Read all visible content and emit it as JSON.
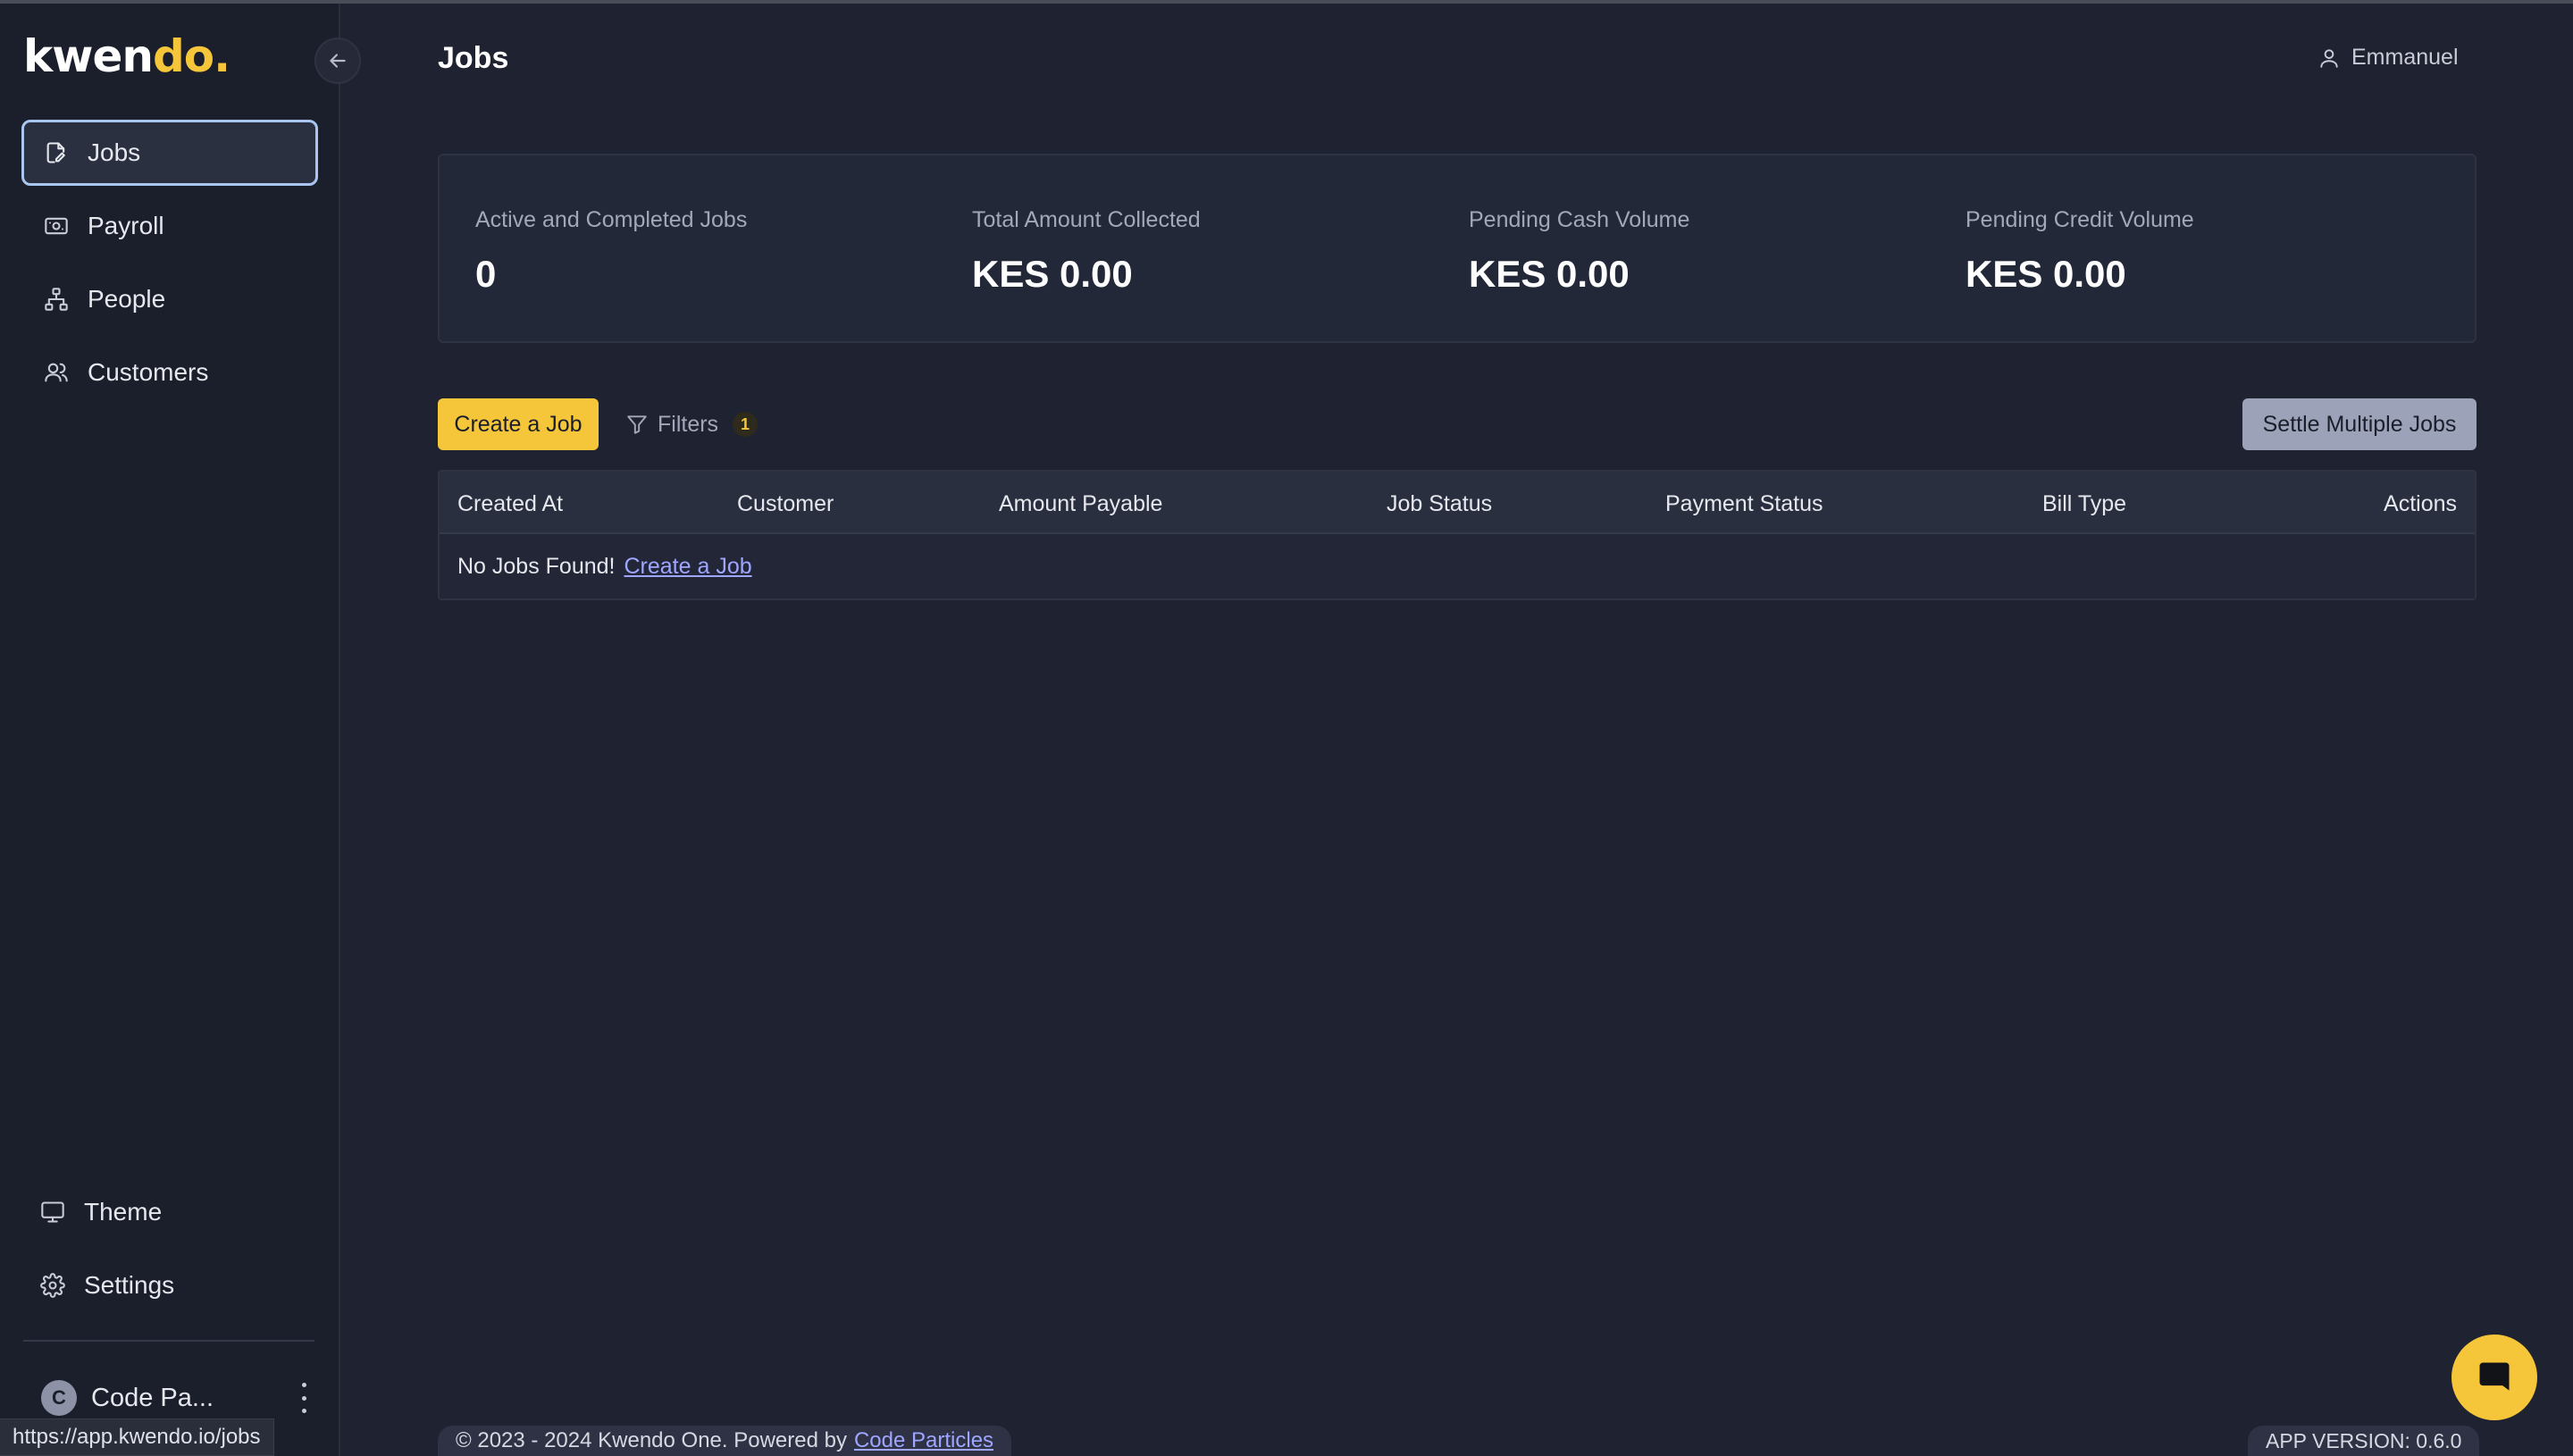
{
  "brand": {
    "logo_main": "kwen",
    "logo_accent": "do."
  },
  "sidebar": {
    "items": [
      {
        "label": "Jobs",
        "icon": "job-edit-icon",
        "active": true
      },
      {
        "label": "Payroll",
        "icon": "cash-icon"
      },
      {
        "label": "People",
        "icon": "org-chart-icon"
      },
      {
        "label": "Customers",
        "icon": "users-icon"
      }
    ],
    "bottom_items": [
      {
        "label": "Theme",
        "icon": "monitor-icon"
      },
      {
        "label": "Settings",
        "icon": "gear-icon"
      }
    ],
    "org": {
      "avatar_initial": "C",
      "name": "Code Pa..."
    },
    "status_url": "https://app.kwendo.io/jobs"
  },
  "header": {
    "title": "Jobs",
    "user_name": "Emmanuel"
  },
  "stats": [
    {
      "label": "Active and Completed Jobs",
      "value": "0"
    },
    {
      "label": "Total Amount Collected",
      "value": "KES 0.00"
    },
    {
      "label": "Pending Cash Volume",
      "value": "KES 0.00"
    },
    {
      "label": "Pending Credit Volume",
      "value": "KES 0.00"
    }
  ],
  "toolbar": {
    "create_label": "Create a Job",
    "filters_label": "Filters",
    "filters_count": "1",
    "settle_label": "Settle Multiple Jobs"
  },
  "table": {
    "columns": [
      "Created At",
      "Customer",
      "Amount Payable",
      "Job Status",
      "Payment Status",
      "Bill Type",
      "Actions"
    ],
    "empty_text": "No Jobs Found!",
    "empty_link": "Create a Job"
  },
  "footer": {
    "copyright": "© 2023 - 2024 Kwendo One.  Powered by",
    "powered_link": "Code Particles",
    "version": "APP VERSION: 0.6.0"
  },
  "colors": {
    "accent": "#f5c53a",
    "background": "#1f2231",
    "sidebar": "#1b1e2b",
    "link": "#9ea6ff"
  }
}
